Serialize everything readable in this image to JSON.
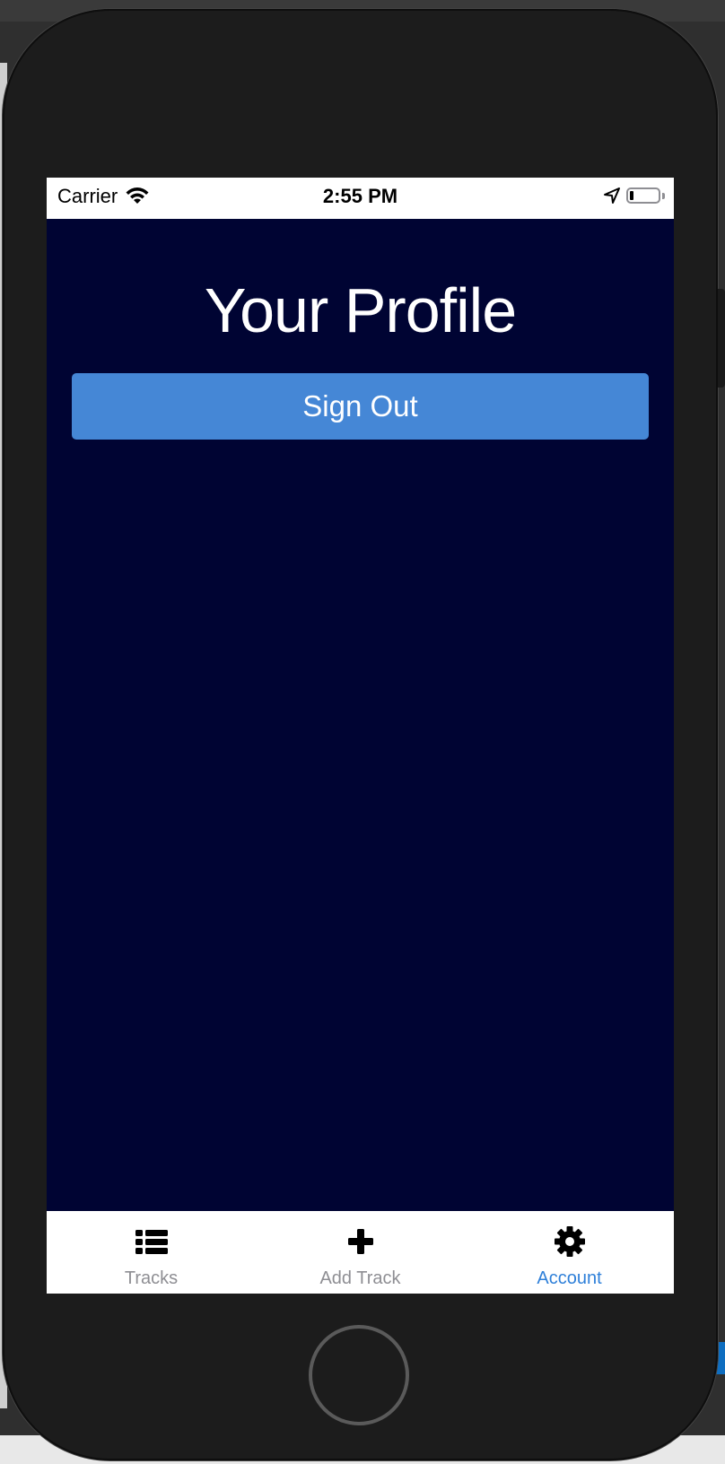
{
  "status_bar": {
    "carrier": "Carrier",
    "time": "2:55 PM",
    "battery_level": 0.12,
    "wifi_icon": "wifi-icon",
    "location_icon": "location-arrow-icon",
    "battery_icon": "battery-icon"
  },
  "profile": {
    "title": "Your Profile",
    "sign_out_label": "Sign Out"
  },
  "tab_bar": {
    "active_tab": "Account",
    "tabs": [
      {
        "label": "Tracks",
        "icon": "list-icon"
      },
      {
        "label": "Add Track",
        "icon": "plus-icon"
      },
      {
        "label": "Account",
        "icon": "gear-icon"
      }
    ]
  },
  "colors": {
    "screen_background": "#000433",
    "button_blue": "#4587d6",
    "active_tab": "#2f80d9",
    "inactive_tab": "#8e8e93"
  }
}
